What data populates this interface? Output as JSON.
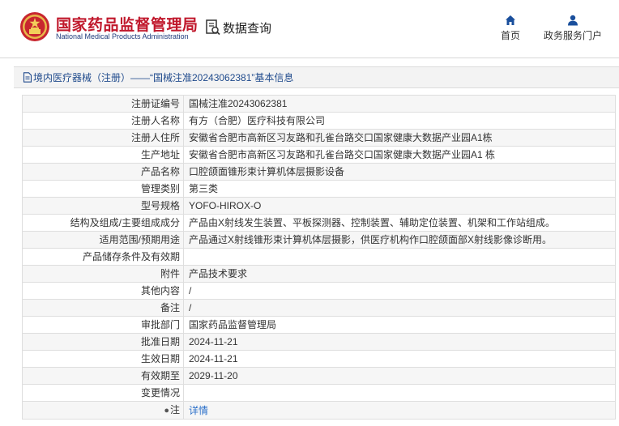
{
  "header": {
    "site_name_cn": "国家药品监督管理局",
    "site_name_en": "National Medical Products Administration",
    "logo_icon": "nmpa-emblem-icon",
    "query_label": "数据查询",
    "query_icon": "data-query-icon",
    "nav": [
      {
        "label": "首页",
        "icon": "home-icon"
      },
      {
        "label": "政务服务门户",
        "icon": "user-icon"
      }
    ]
  },
  "title_bar": {
    "icon": "document-icon",
    "text": "境内医疗器械（注册）——“国械注准20243062381”基本信息"
  },
  "details": [
    {
      "label": "注册证编号",
      "value": "国械注准20243062381"
    },
    {
      "label": "注册人名称",
      "value": "有方（合肥）医疗科技有限公司"
    },
    {
      "label": "注册人住所",
      "value": "安徽省合肥市高新区习友路和孔雀台路交口国家健康大数据产业园A1栋"
    },
    {
      "label": "生产地址",
      "value": "安徽省合肥市高新区习友路和孔雀台路交口国家健康大数据产业园A1 栋"
    },
    {
      "label": "产品名称",
      "value": "口腔颌面锥形束计算机体层摄影设备"
    },
    {
      "label": "管理类别",
      "value": "第三类"
    },
    {
      "label": "型号规格",
      "value": "YOFO-HIROX-O"
    },
    {
      "label": "结构及组成/主要组成成分",
      "value": "产品由X射线发生装置、平板探测器、控制装置、辅助定位装置、机架和工作站组成。"
    },
    {
      "label": "适用范围/预期用途",
      "value": "产品通过X射线锥形束计算机体层摄影，供医疗机构作口腔颌面部X射线影像诊断用。"
    },
    {
      "label": "产品储存条件及有效期",
      "value": ""
    },
    {
      "label": "附件",
      "value": "产品技术要求"
    },
    {
      "label": "其他内容",
      "value": "/"
    },
    {
      "label": "备注",
      "value": "/"
    },
    {
      "label": "审批部门",
      "value": "国家药品监督管理局"
    },
    {
      "label": "批准日期",
      "value": "2024-11-21"
    },
    {
      "label": "生效日期",
      "value": "2024-11-21"
    },
    {
      "label": "有效期至",
      "value": "2029-11-20"
    },
    {
      "label": "变更情况",
      "value": ""
    }
  ],
  "note_row": {
    "icon": "pin-icon",
    "label": "注",
    "link": "详情"
  },
  "colors": {
    "brand_red": "#c0172b",
    "brand_blue": "#1e3a7b",
    "link_blue": "#2a6fc9",
    "nav_blue": "#1f4a8c"
  }
}
